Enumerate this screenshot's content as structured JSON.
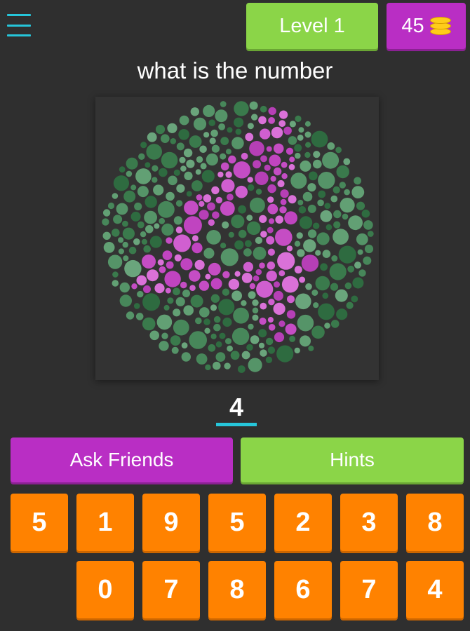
{
  "header": {
    "menu_icon": "hamburger-menu-icon",
    "level_label": "Level 1",
    "coins": "45",
    "coin_icon": "coin-stack-icon"
  },
  "question": "what is the number",
  "plate": {
    "digit_shown": "4",
    "colors": {
      "background_dots": [
        "#2e6b40",
        "#3a7a4c",
        "#47875a",
        "#559468",
        "#62a074",
        "#6aa57c"
      ],
      "figure_dots": [
        "#b63fb6",
        "#c54dc4",
        "#d05fd0",
        "#da71d8",
        "#c044c0"
      ]
    }
  },
  "answer": {
    "value": "4"
  },
  "actions": {
    "ask_friends": "Ask Friends",
    "hints": "Hints"
  },
  "keyboard": {
    "row1": [
      "5",
      "1",
      "9",
      "5",
      "2",
      "3",
      "8"
    ],
    "row2": [
      "0",
      "7",
      "8",
      "6",
      "7",
      "4"
    ]
  },
  "colors": {
    "background": "#2f2f2f",
    "accent_cyan": "#26c6da",
    "green": "#8bd548",
    "purple": "#b92ec4",
    "orange": "#ff8200"
  }
}
